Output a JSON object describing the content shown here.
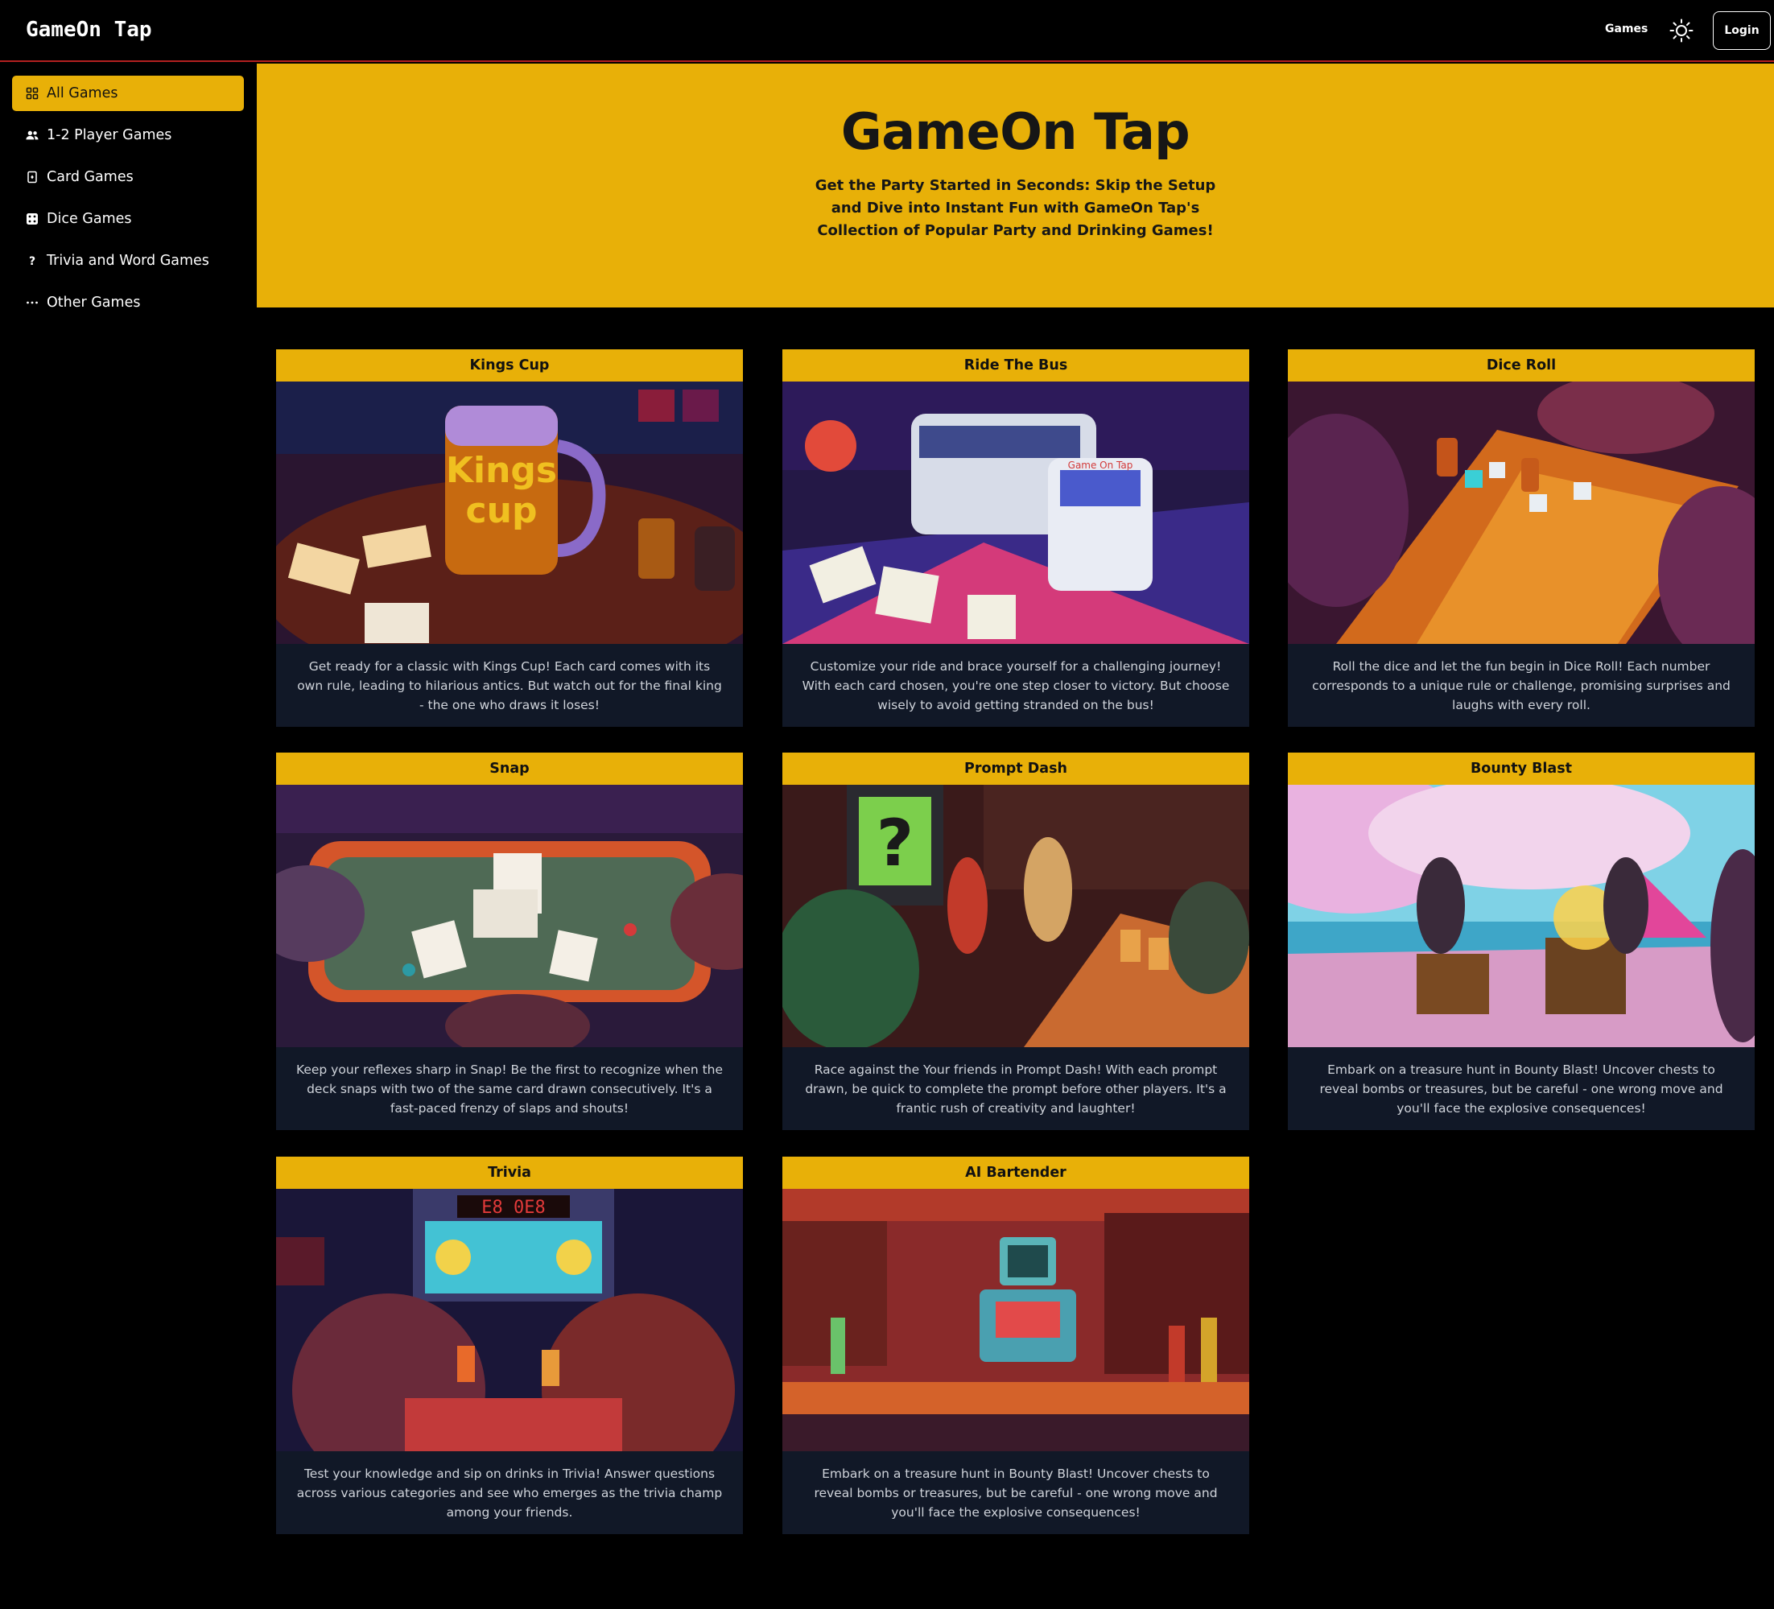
{
  "app": {
    "brand": "GameOn Tap"
  },
  "nav": {
    "games_label": "Games",
    "login_label": "Login",
    "theme_icon": "sun-icon"
  },
  "sidebar": {
    "items": [
      {
        "label": "All Games",
        "icon": "grid-icon",
        "active": true
      },
      {
        "label": "1-2 Player Games",
        "icon": "users-icon",
        "active": false
      },
      {
        "label": "Card Games",
        "icon": "card-icon",
        "active": false
      },
      {
        "label": "Dice Games",
        "icon": "dice-icon",
        "active": false
      },
      {
        "label": "Trivia and Word Games",
        "icon": "question-icon",
        "active": false
      },
      {
        "label": "Other Games",
        "icon": "ellipsis-icon",
        "active": false
      }
    ]
  },
  "hero": {
    "title": "GameOn Tap",
    "subtitle": "Get the Party Started in Seconds: Skip the Setup and Dive into Instant Fun with GameOn Tap's Collection of Popular Party and Drinking Games!"
  },
  "games": [
    {
      "title": "Kings Cup",
      "description": "Get ready for a classic with Kings Cup! Each card comes with its own rule, leading to hilarious antics. But watch out for the final king - the one who draws it loses!"
    },
    {
      "title": "Ride The Bus",
      "description": "Customize your ride and brace yourself for a challenging journey! With each card chosen, you're one step closer to victory. But choose wisely to avoid getting stranded on the bus!"
    },
    {
      "title": "Dice Roll",
      "description": "Roll the dice and let the fun begin in Dice Roll! Each number corresponds to a unique rule or challenge, promising surprises and laughs with every roll."
    },
    {
      "title": "Snap",
      "description": "Keep your reflexes sharp in Snap! Be the first to recognize when the deck snaps with two of the same card drawn consecutively. It's a fast-paced frenzy of slaps and shouts!"
    },
    {
      "title": "Prompt Dash",
      "description": "Race against the Your friends in Prompt Dash! With each prompt drawn, be quick to complete the prompt before other players. It's a frantic rush of creativity and laughter!"
    },
    {
      "title": "Bounty Blast",
      "description": "Embark on a treasure hunt in Bounty Blast! Uncover chests to reveal bombs or treasures, but be careful - one wrong move and you'll face the explosive consequences!"
    },
    {
      "title": "Trivia",
      "description": "Test your knowledge and sip on drinks in Trivia! Answer questions across various categories and see who emerges as the trivia champ among your friends."
    },
    {
      "title": "AI Bartender",
      "description": "Embark on a treasure hunt in Bounty Blast! Uncover chests to reveal bombs or treasures, but be careful - one wrong move and you'll face the explosive consequences!"
    }
  ],
  "colors": {
    "accent": "#e8b008",
    "card_bg": "#111827",
    "page_bg": "#000000",
    "topbar_border": "#b32020"
  }
}
